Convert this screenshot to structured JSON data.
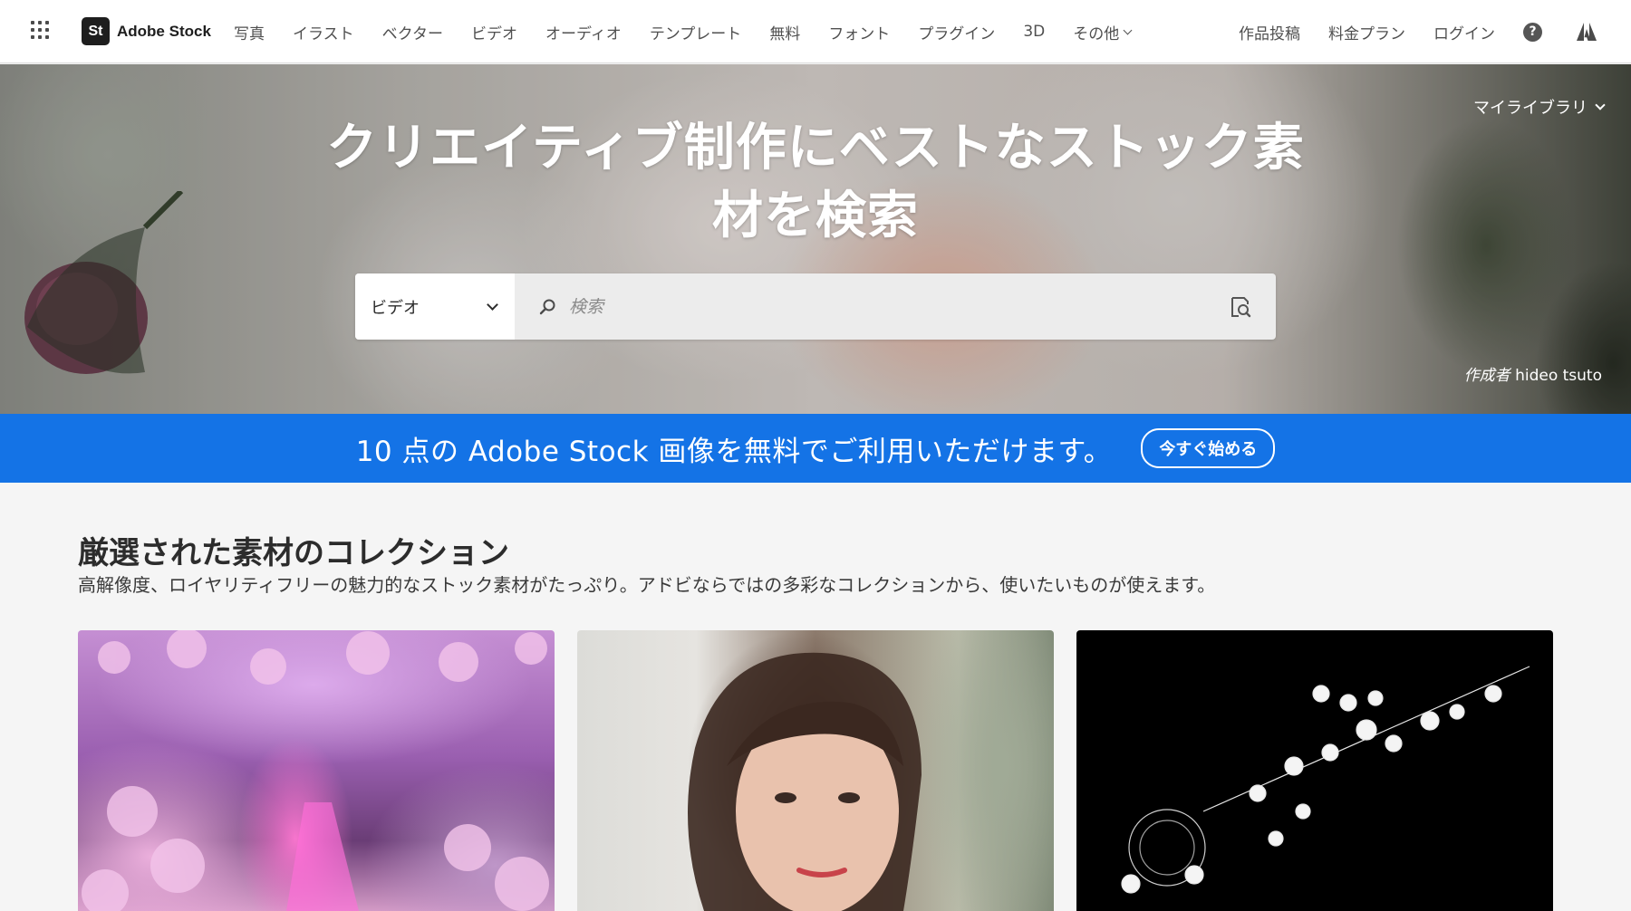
{
  "topnav": {
    "brand_logo": "St",
    "brand_name": "Adobe Stock",
    "links": [
      "写真",
      "イラスト",
      "ベクター",
      "ビデオ",
      "オーディオ",
      "テンプレート",
      "無料",
      "フォント",
      "プラグイン",
      "3D"
    ],
    "more_label": "その他",
    "right_links": [
      "作品投稿",
      "料金プラン",
      "ログイン"
    ],
    "help_icon_glyph": "?"
  },
  "hero": {
    "title_line1": "クリエイティブ制作にベストなストック素",
    "title_line2": "材を検索",
    "my_library_label": "マイライブラリ",
    "search": {
      "type_selected": "ビデオ",
      "placeholder": "検索",
      "value": ""
    },
    "credit_prefix": "作成者",
    "credit_name": "hideo tsuto"
  },
  "promo": {
    "text": "10 点の Adobe Stock 画像を無料でご利用いただけます。",
    "button_label": "今すぐ始める"
  },
  "collection": {
    "title": "厳選された素材のコレクション",
    "description": "高解像度、ロイヤリティフリーの魅力的なストック素材がたっぷり。アドビならではの多彩なコレクションから、使いたいものが使えます。"
  },
  "colors": {
    "accent_blue": "#1473e6",
    "nav_text": "#505050",
    "background": "#f5f5f5"
  },
  "icons": [
    "app-grid-icon",
    "search-icon",
    "visual-search-icon",
    "help-icon",
    "adobe-logo-icon",
    "chevron-down-icon"
  ]
}
